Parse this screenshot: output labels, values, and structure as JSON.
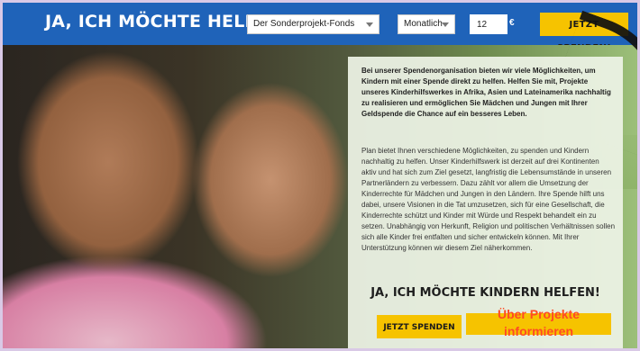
{
  "header": {
    "title": "JA, ICH MÖCHTE HELFEN!",
    "project_select": "Der Sonderprojekt-Fonds",
    "interval_select": "Monatlich",
    "amount_value": "12",
    "currency": "€",
    "donate_button": "JETZT SPENDEN!"
  },
  "content": {
    "lead": "Bei unserer Spendenorganisation bieten wir viele Möglichkeiten, um Kindern mit einer Spende direkt zu helfen. Helfen Sie mit, Projekte unseres Kinderhilfswerkes in Afrika, Asien und Lateinamerika nachhaltig zu realisieren und ermöglichen Sie Mädchen und Jungen mit Ihrer Geldspende die Chance auf ein besseres Leben.",
    "body": "Plan bietet Ihnen verschiedene Möglichkeiten, zu spenden und Kindern nachhaltig zu helfen. Unser Kinderhilfswerk ist derzeit auf drei Kontinenten aktiv und hat sich zum Ziel gesetzt, langfristig die Lebensumstände in unseren Partnerländern zu verbessern. Dazu zählt vor allem die Umsetzung der Kinderrechte für Mädchen und Jungen in den Ländern. Ihre Spende hilft uns dabei, unsere Visionen in die Tat umzusetzen, sich für eine Gesellschaft, die Kinderrechte schützt und Kinder mit Würde und Respekt behandelt ein zu setzen. Unabhängig von Herkunft, Religion und politischen Verhältnissen sollen sich alle Kinder frei entfalten und sicher entwickeln können. Mit Ihrer Unterstützung können wir diesem Ziel näherkommen.",
    "cta_title": "JA, ICH MÖCHTE KINDERN HELFEN!",
    "cta_donate": "JETZT SPENDEN",
    "cta_info": "Über Projekte informieren"
  },
  "colors": {
    "header_bg": "#1f63b9",
    "accent_yellow": "#f6c300",
    "info_text": "#ff4a24"
  },
  "icons": {
    "dropdown": "chevron-down-icon"
  }
}
